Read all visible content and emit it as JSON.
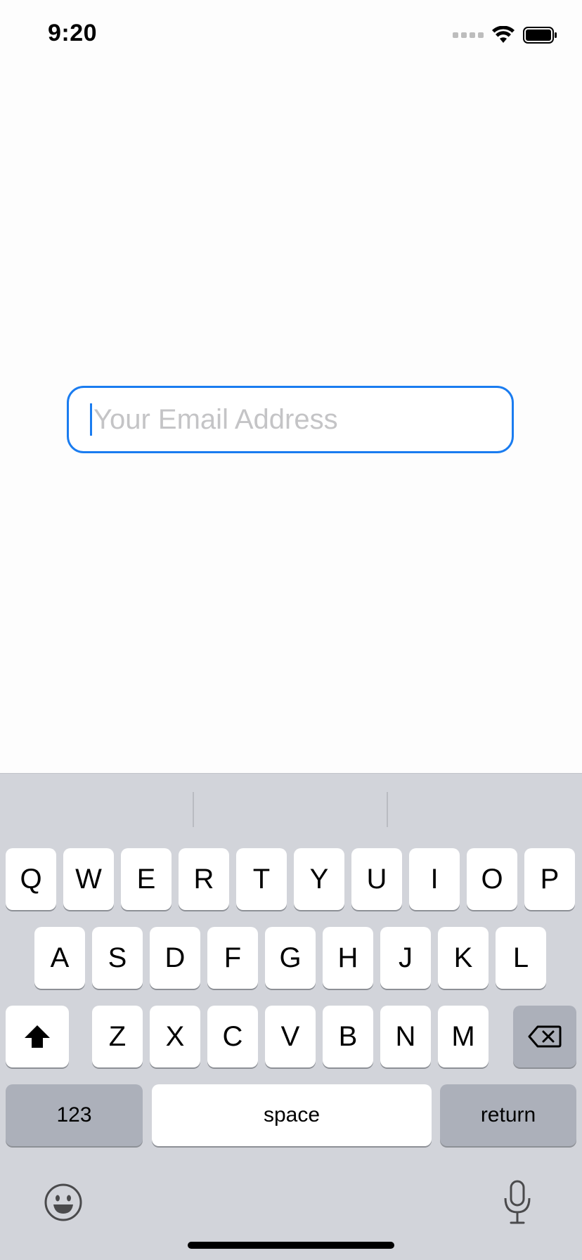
{
  "status_bar": {
    "time": "9:20"
  },
  "email_field": {
    "placeholder": "Your Email Address",
    "value": ""
  },
  "keyboard": {
    "row1": [
      "Q",
      "W",
      "E",
      "R",
      "T",
      "Y",
      "U",
      "I",
      "O",
      "P"
    ],
    "row2": [
      "A",
      "S",
      "D",
      "F",
      "G",
      "H",
      "J",
      "K",
      "L"
    ],
    "row3": [
      "Z",
      "X",
      "C",
      "V",
      "B",
      "N",
      "M"
    ],
    "numbers_key": "123",
    "space_key": "space",
    "return_key": "return"
  },
  "icons": {
    "shift": "shift-icon",
    "backspace": "backspace-icon",
    "emoji": "emoji-icon",
    "mic": "microphone-icon",
    "wifi": "wifi-icon",
    "battery": "battery-icon"
  },
  "colors": {
    "accent": "#1a7cf0",
    "keyboard_bg": "#d2d4da",
    "dark_key": "#acb0ba"
  }
}
